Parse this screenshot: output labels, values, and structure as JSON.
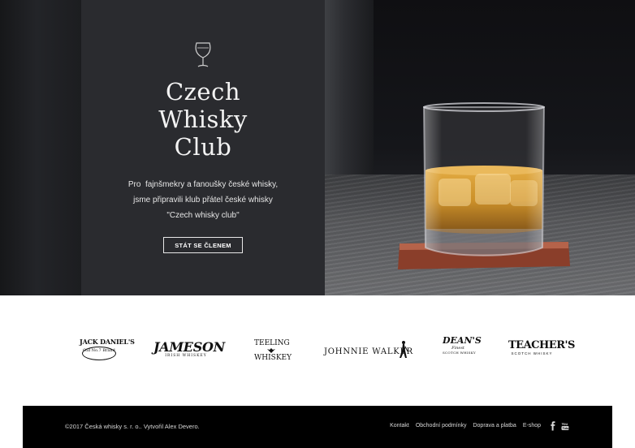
{
  "hero": {
    "title_lines": [
      "Czech",
      "Whisky",
      "Club"
    ],
    "text_lines": [
      "Pro  fajnšmekry a fanoušky české whisky,",
      "jsme připravili klub přátel české whisky",
      "\"Czech whisky club\""
    ],
    "join_button": "STÁT SE ČLENEM",
    "icon": "wine-glass-icon"
  },
  "brands": {
    "jack_daniels": {
      "name": "JACK DANIEL'S",
      "badge_line1": "Old",
      "badge_line2": "No.7",
      "badge_line3": "Brand"
    },
    "jameson": {
      "name": "JAMESON",
      "sub": "IRISH WHISKEY"
    },
    "teeling": {
      "line1": "TEELING",
      "line2": "WHISKEY"
    },
    "johnnie_walker": {
      "name": "JOHNNIE WALKER"
    },
    "deans": {
      "name": "DEAN'S",
      "sub": "Finest",
      "sub2": "SCOTCH WHISKY"
    },
    "teachers": {
      "name": "TEACHER'S",
      "sub": "SCOTCH WHISKY"
    }
  },
  "footer": {
    "copyright": "©2017 Česká whisky s. r. o.. Vytvořil Alex Devero.",
    "nav": [
      "Kontakt",
      "Obchodní podmínky",
      "Doprava a platba",
      "E-shop"
    ],
    "social_icons": [
      "facebook-icon",
      "youtube-icon"
    ]
  },
  "colors": {
    "panel": "#2a2b2f",
    "footer_bg": "#000000",
    "whisky": "#c98a1e"
  }
}
